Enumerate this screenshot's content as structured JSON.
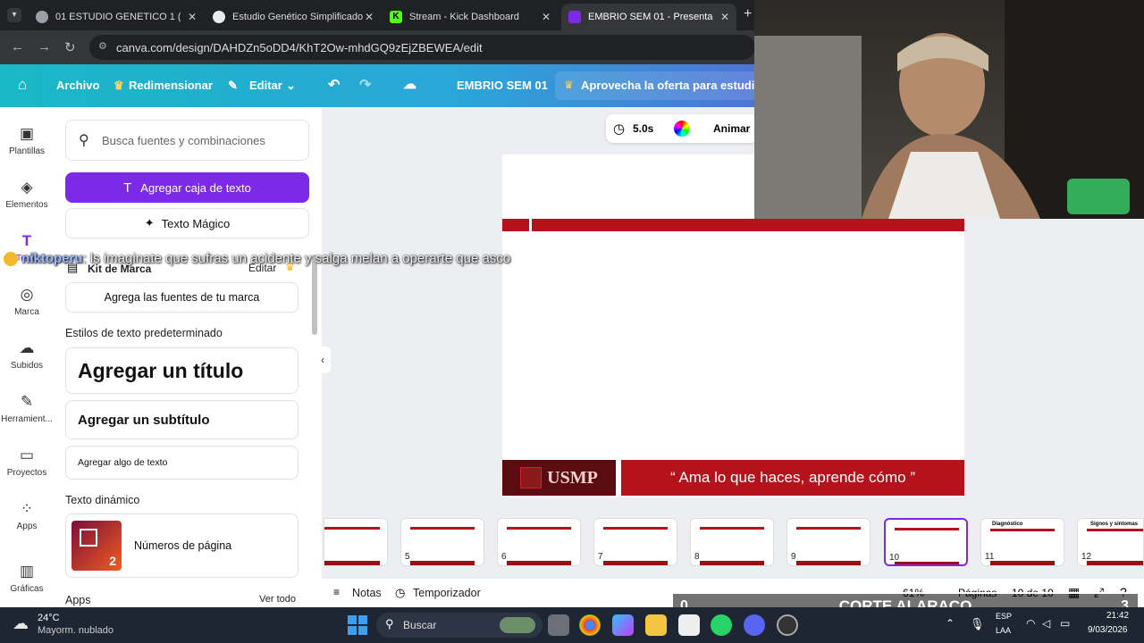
{
  "browser": {
    "tabs": [
      {
        "title": "01 ESTUDIO GENETICO 1 (2) (1)",
        "icon_color": "#9aa0a6"
      },
      {
        "title": "Estudio Genético Simplificado",
        "icon_color": "#e8eaed"
      },
      {
        "title": "Stream - Kick Dashboard",
        "icon_color": "#53fc18"
      },
      {
        "title": "EMBRIO SEM 01 - Presentación",
        "icon_color": "#7d2ae8"
      }
    ],
    "url": "canva.com/design/DAHDZn5oDD4/KhT2Ow-mhdGQ9zEjZBEWEA/edit"
  },
  "toolbar": {
    "file": "Archivo",
    "resize": "Redimensionar",
    "edit": "Editar",
    "doc_title": "EMBRIO SEM 01",
    "offer": "Aprovecha la oferta para estudiam"
  },
  "rail": [
    "Plantillas",
    "Elementos",
    "Texto",
    "Marca",
    "Subidos",
    "Herramient...",
    "Proyectos",
    "Apps",
    "Gráficas"
  ],
  "panel": {
    "search_placeholder": "Busca fuentes y combinaciones",
    "add_text_box": "Agregar caja de texto",
    "magic_text": "Texto Mágico",
    "brand_kit": "Kit de Marca",
    "brand_edit": "Editar",
    "add_brand_fonts": "Agrega las fuentes de tu marca",
    "default_styles": "Estilos de texto predeterminado",
    "add_title": "Agregar un título",
    "add_subtitle": "Agregar un subtítulo",
    "add_body": "Agregar algo de texto",
    "dynamic_text": "Texto dinámico",
    "page_numbers": "Números de página",
    "page_numbers_badge": "2",
    "apps": "Apps",
    "see_all": "Ver todo"
  },
  "canvas": {
    "duration": "5.0s",
    "animate": "Animar",
    "slide_logo": "USMP",
    "slide_quote": "“ Ama lo que haces, aprende cómo ”",
    "brand_color": "#b5121b",
    "thumbnails": [
      {
        "n": "",
        "title": ""
      },
      {
        "n": "5",
        "title": ""
      },
      {
        "n": "6",
        "title": ""
      },
      {
        "n": "7",
        "title": ""
      },
      {
        "n": "8",
        "title": ""
      },
      {
        "n": "9",
        "title": ""
      },
      {
        "n": "10",
        "title": ""
      },
      {
        "n": "11",
        "title": "Diagnóstico"
      },
      {
        "n": "12",
        "title": "Signos y síntomas"
      }
    ],
    "notes": "Notas",
    "timer": "Temporizador",
    "zoom": "61%",
    "pages": "Páginas",
    "page_count": "10 de 10"
  },
  "overlay": {
    "chat_user": "niktoperu",
    "chat_message": ": ls imaginate que sufras un acidente y salga melan a operarte que asco",
    "score_left": "0",
    "score_title": "CORTE ALARACO",
    "score_right": "3"
  },
  "taskbar": {
    "temp": "24°C",
    "weather": "Mayorm. nublado",
    "search": "Buscar",
    "lang1": "ESP",
    "lang2": "LAA",
    "time": "21:42",
    "date": "9/03/2026"
  }
}
